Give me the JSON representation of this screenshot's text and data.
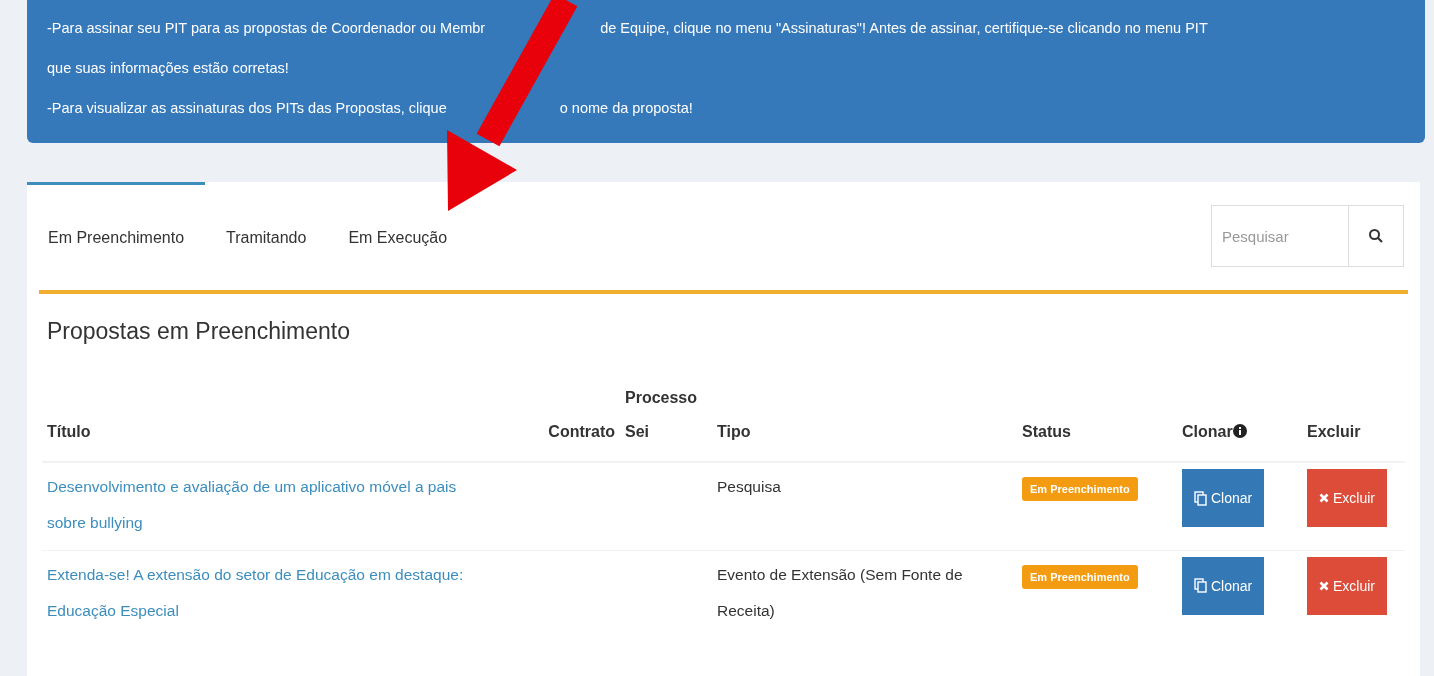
{
  "notice": {
    "lines": [
      [
        "-Para assinar seu PIT para as propostas de Coordenador ou Membr",
        "de Equipe, clique no menu \"Assinaturas\"! Antes de assinar, certifique-se clicando no menu PIT"
      ],
      [
        "que suas informações estão corretas!"
      ],
      [
        "-Para visualizar as assinaturas dos PITs das Propostas, clique",
        "o nome da proposta!"
      ]
    ]
  },
  "tabs": [
    {
      "label": "Em Preenchimento",
      "selected": true
    },
    {
      "label": "Tramitando",
      "selected": false
    },
    {
      "label": "Em Execução",
      "selected": false
    }
  ],
  "search": {
    "placeholder": "Pesquisar"
  },
  "heading": "Propostas em Preenchimento",
  "table": {
    "columns": [
      "Título",
      "Contrato",
      "Processo Sei",
      "Tipo",
      "Status",
      "Clonar",
      "Excluir"
    ],
    "rows": [
      {
        "titulo": "Desenvolvimento e avaliação de um aplicativo móvel a pais sobre bullying",
        "tipo": "Pesquisa",
        "status": "Em Preenchimento",
        "clone": "Clonar",
        "delete": "Excluir"
      },
      {
        "titulo": "Extenda-se! A extensão do setor de Educação em destaque: Educação Especial",
        "tipo": "Evento de Extensão (Sem Fonte de Receita)",
        "status": "Em Preenchimento",
        "clone": "Clonar",
        "delete": "Excluir"
      }
    ]
  }
}
